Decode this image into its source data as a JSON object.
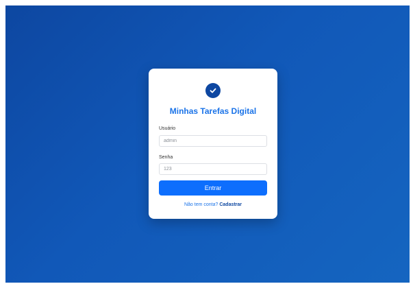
{
  "app": {
    "title": "Minhas Tarefas Digital",
    "brand_color": "#0d47a1",
    "accent_color": "#0d6efd",
    "logo_icon": "check-circle-icon"
  },
  "form": {
    "username_label": "Usuário",
    "username_value": "admin",
    "password_label": "Senha",
    "password_value": "123",
    "submit_label": "Entrar"
  },
  "signup": {
    "prompt": "Não tem conta? ",
    "link": "Cadastrar"
  }
}
